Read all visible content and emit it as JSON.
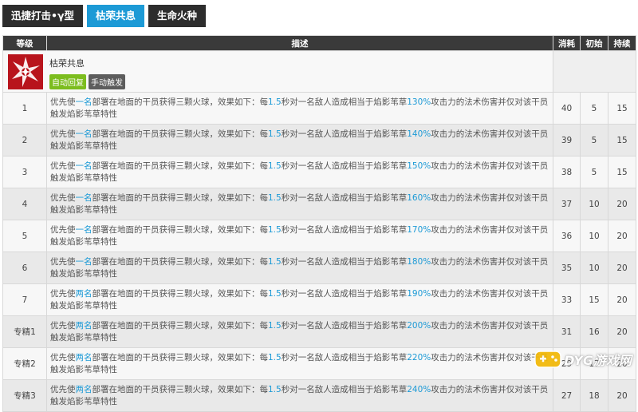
{
  "tabs": [
    {
      "label": "迅捷打击•γ型",
      "active": false
    },
    {
      "label": "枯荣共息",
      "active": true
    },
    {
      "label": "生命火种",
      "active": false
    }
  ],
  "skill": {
    "icon": "red-star-emblem-icon",
    "name": "枯荣共息",
    "recovery_badge": "自动回复",
    "trigger_badge": "手动触发"
  },
  "columns": {
    "level": "等级",
    "desc": "描述",
    "cost": "消耗",
    "initial": "初始",
    "duration": "持续"
  },
  "rows": [
    {
      "level": "1",
      "pre": "优先使",
      "count": "一名",
      "mid": "部署在地面的干员获得三颗火球，效果如下：每",
      "interval": "1.5",
      "mid2": "秒对一名敌人造成相当于焰影苇草",
      "pct": "130%",
      "post": "攻击力的法术伤害并仅对该干员触发焰影苇草特性",
      "cost": "40",
      "initial": "5",
      "duration": "15"
    },
    {
      "level": "2",
      "pre": "优先使",
      "count": "一名",
      "mid": "部署在地面的干员获得三颗火球，效果如下：每",
      "interval": "1.5",
      "mid2": "秒对一名敌人造成相当于焰影苇草",
      "pct": "140%",
      "post": "攻击力的法术伤害并仅对该干员触发焰影苇草特性",
      "cost": "39",
      "initial": "5",
      "duration": "15"
    },
    {
      "level": "3",
      "pre": "优先使",
      "count": "一名",
      "mid": "部署在地面的干员获得三颗火球，效果如下：每",
      "interval": "1.5",
      "mid2": "秒对一名敌人造成相当于焰影苇草",
      "pct": "150%",
      "post": "攻击力的法术伤害并仅对该干员触发焰影苇草特性",
      "cost": "38",
      "initial": "5",
      "duration": "15"
    },
    {
      "level": "4",
      "pre": "优先使",
      "count": "一名",
      "mid": "部署在地面的干员获得三颗火球，效果如下：每",
      "interval": "1.5",
      "mid2": "秒对一名敌人造成相当于焰影苇草",
      "pct": "160%",
      "post": "攻击力的法术伤害并仅对该干员触发焰影苇草特性",
      "cost": "37",
      "initial": "10",
      "duration": "20"
    },
    {
      "level": "5",
      "pre": "优先使",
      "count": "一名",
      "mid": "部署在地面的干员获得三颗火球，效果如下：每",
      "interval": "1.5",
      "mid2": "秒对一名敌人造成相当于焰影苇草",
      "pct": "170%",
      "post": "攻击力的法术伤害并仅对该干员触发焰影苇草特性",
      "cost": "36",
      "initial": "10",
      "duration": "20"
    },
    {
      "level": "6",
      "pre": "优先使",
      "count": "一名",
      "mid": "部署在地面的干员获得三颗火球，效果如下：每",
      "interval": "1.5",
      "mid2": "秒对一名敌人造成相当于焰影苇草",
      "pct": "180%",
      "post": "攻击力的法术伤害并仅对该干员触发焰影苇草特性",
      "cost": "35",
      "initial": "10",
      "duration": "20"
    },
    {
      "level": "7",
      "pre": "优先使",
      "count": "两名",
      "mid": "部署在地面的干员获得三颗火球，效果如下：每",
      "interval": "1.5",
      "mid2": "秒对一名敌人造成相当于焰影苇草",
      "pct": "190%",
      "post": "攻击力的法术伤害并仅对该干员触发焰影苇草特性",
      "cost": "33",
      "initial": "15",
      "duration": "20"
    },
    {
      "level": "专精1",
      "pre": "优先使",
      "count": "两名",
      "mid": "部署在地面的干员获得三颗火球，效果如下：每",
      "interval": "1.5",
      "mid2": "秒对一名敌人造成相当于焰影苇草",
      "pct": "200%",
      "post": "攻击力的法术伤害并仅对该干员触发焰影苇草特性",
      "cost": "31",
      "initial": "16",
      "duration": "20"
    },
    {
      "level": "专精2",
      "pre": "优先使",
      "count": "两名",
      "mid": "部署在地面的干员获得三颗火球，效果如下：每",
      "interval": "1.5",
      "mid2": "秒对一名敌人造成相当于焰影苇草",
      "pct": "220%",
      "post": "攻击力的法术伤害并仅对该干员触发焰影苇草特性",
      "cost": "29",
      "initial": "17",
      "duration": "20"
    },
    {
      "level": "专精3",
      "pre": "优先使",
      "count": "两名",
      "mid": "部署在地面的干员获得三颗火球，效果如下：每",
      "interval": "1.5",
      "mid2": "秒对一名敌人造成相当于焰影苇草",
      "pct": "240%",
      "post": "攻击力的法术伤害并仅对该干员触发焰影苇草特性",
      "cost": "27",
      "initial": "18",
      "duration": "20"
    }
  ],
  "watermark": {
    "text": "DYG游戏网",
    "icon": "gamepad-icon"
  },
  "colors": {
    "accent": "#1c9ad6",
    "tab_dark": "#2d2d2d",
    "header": "#3a3a3a",
    "badge_green": "#7cbd1e",
    "badge_grey": "#5d5d5d",
    "icon_red": "#b8141c"
  }
}
